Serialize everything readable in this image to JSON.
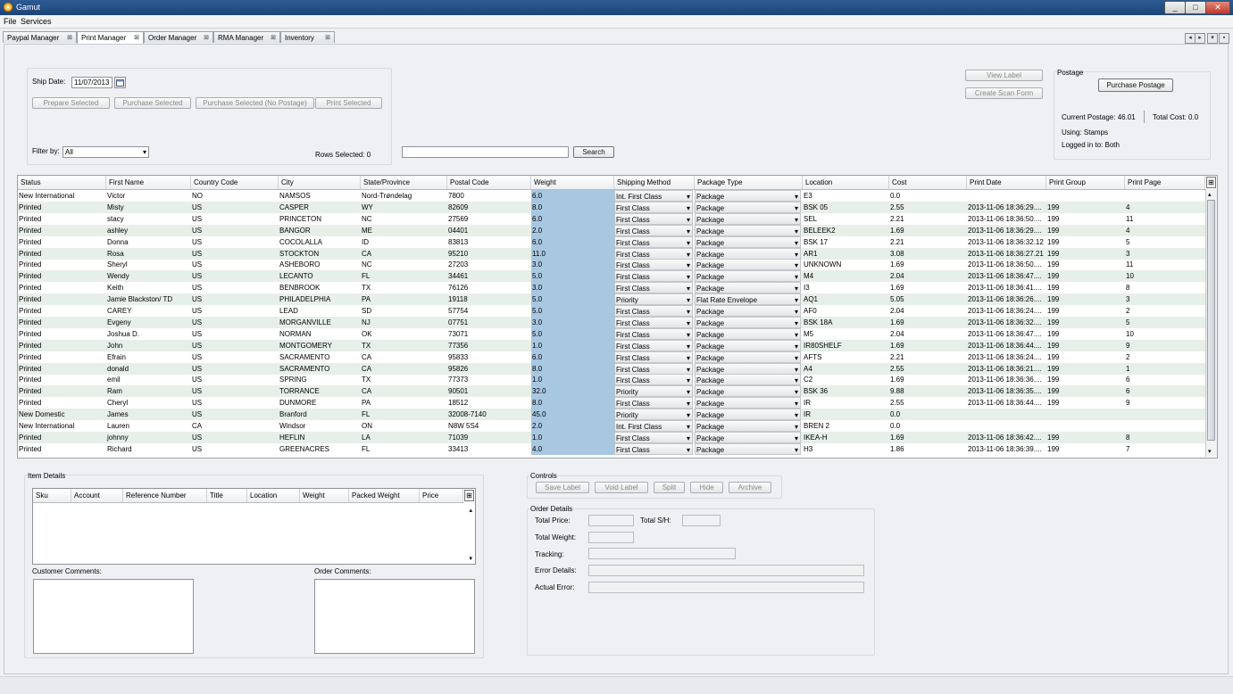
{
  "window": {
    "title": "Gamut",
    "controls": [
      "_",
      "□",
      "✕"
    ]
  },
  "menu": [
    "File",
    "Services"
  ],
  "tabs": [
    "Paypal Manager",
    "Print Manager",
    "Order Manager",
    "RMA Manager",
    "Inventory"
  ],
  "tab_close": "⊠",
  "nav": [
    "◂",
    "▸",
    "▾",
    "▪"
  ],
  "toolbar": {
    "ship_date_label": "Ship Date:",
    "ship_date_value": "11/07/2013",
    "prepare_selected": "Prepare Selected",
    "purchase_selected": "Purchase Selected",
    "purchase_no_postage": "Purchase Selected (No Postage)",
    "print_selected": "Print Selected",
    "filter_label": "Filter by:",
    "filter_value": "All",
    "rows_selected": "Rows Selected:  0",
    "search_button": "Search",
    "view_label": "View Label",
    "create_scan_form": "Create Scan Form"
  },
  "postage": {
    "title": "Postage",
    "purchase_button": "Purchase Postage",
    "current_postage": "Current Postage:  46.01",
    "total_cost": "Total Cost:  0.0",
    "using": "Using:  Stamps",
    "logged_in": "Logged in to:  Both"
  },
  "table": {
    "columns": [
      "Status",
      "First Name",
      "Country Code",
      "City",
      "State/Province",
      "Postal Code",
      "Weight",
      "Shipping Method",
      "Package Type",
      "Location",
      "Cost",
      "Print Date",
      "Print Group",
      "Print Page"
    ],
    "rows": [
      [
        "New International",
        "Victor",
        "NO",
        "NAMSOS",
        "Nord-Trøndelag",
        "7800",
        "6.0",
        "Int. First Class",
        "Package",
        "E3",
        "0.0",
        "",
        "",
        ""
      ],
      [
        "Printed",
        "Misty",
        "US",
        "CASPER",
        "WY",
        "82609",
        "8.0",
        "First Class",
        "Package",
        "BSK 05",
        "2.55",
        "2013-11-06 18:36:29....",
        "199",
        "4"
      ],
      [
        "Printed",
        "stacy",
        "US",
        "PRINCETON",
        "NC",
        "27569",
        "6.0",
        "First Class",
        "Package",
        "SEL",
        "2.21",
        "2013-11-06 18:36:50....",
        "199",
        "11"
      ],
      [
        "Printed",
        "ashley",
        "US",
        "BANGOR",
        "ME",
        "04401",
        "2.0",
        "First Class",
        "Package",
        "BELEEK2",
        "1.69",
        "2013-11-06 18:36:29....",
        "199",
        "4"
      ],
      [
        "Printed",
        "Donna",
        "US",
        "COCOLALLA",
        "ID",
        "83813",
        "6.0",
        "First Class",
        "Package",
        "BSK 17",
        "2.21",
        "2013-11-06 18:36:32.12",
        "199",
        "5"
      ],
      [
        "Printed",
        "Rosa",
        "US",
        "STOCKTON",
        "CA",
        "95210",
        "11.0",
        "First Class",
        "Package",
        "AR1",
        "3.08",
        "2013-11-06 18:36:27.21",
        "199",
        "3"
      ],
      [
        "Printed",
        "Sheryl",
        "US",
        "ASHEBORO",
        "NC",
        "27203",
        "3.0",
        "First Class",
        "Package",
        "UNKNOWN",
        "1.69",
        "2013-11-06 18:36:50....",
        "199",
        "11"
      ],
      [
        "Printed",
        "Wendy",
        "US",
        "LECANTO",
        "FL",
        "34461",
        "5.0",
        "First Class",
        "Package",
        "M4",
        "2.04",
        "2013-11-06 18:36:47....",
        "199",
        "10"
      ],
      [
        "Printed",
        "Keith",
        "US",
        "BENBROOK",
        "TX",
        "76126",
        "3.0",
        "First Class",
        "Package",
        "I3",
        "1.69",
        "2013-11-06 18:36:41....",
        "199",
        "8"
      ],
      [
        "Printed",
        "Jamie Blackston/ TD",
        "US",
        "PHILADELPHIA",
        "PA",
        "19118",
        "5.0",
        "Priority",
        "Flat Rate Envelope",
        "AQ1",
        "5.05",
        "2013-11-06 18:36:26....",
        "199",
        "3"
      ],
      [
        "Printed",
        "CAREY",
        "US",
        "LEAD",
        "SD",
        "57754",
        "5.0",
        "First Class",
        "Package",
        "AF0",
        "2.04",
        "2013-11-06 18:36:24....",
        "199",
        "2"
      ],
      [
        "Printed",
        "Evgeny",
        "US",
        "MORGANVILLE",
        "NJ",
        "07751",
        "3.0",
        "First Class",
        "Package",
        "BSK 18A",
        "1.69",
        "2013-11-06 18:36:32....",
        "199",
        "5"
      ],
      [
        "Printed",
        "Joshua D.",
        "US",
        "NORMAN",
        "OK",
        "73071",
        "5.0",
        "First Class",
        "Package",
        "M5",
        "2.04",
        "2013-11-06 18:36:47....",
        "199",
        "10"
      ],
      [
        "Printed",
        "John",
        "US",
        "MONTGOMERY",
        "TX",
        "77356",
        "1.0",
        "First Class",
        "Package",
        "IR80SHELF",
        "1.69",
        "2013-11-06 18:36:44....",
        "199",
        "9"
      ],
      [
        "Printed",
        "Efrain",
        "US",
        "SACRAMENTO",
        "CA",
        "95833",
        "6.0",
        "First Class",
        "Package",
        "AFTS",
        "2.21",
        "2013-11-06 18:36:24....",
        "199",
        "2"
      ],
      [
        "Printed",
        "donald",
        "US",
        "SACRAMENTO",
        "CA",
        "95826",
        "8.0",
        "First Class",
        "Package",
        "A4",
        "2.55",
        "2013-11-06 18:36:21....",
        "199",
        "1"
      ],
      [
        "Printed",
        "emil",
        "US",
        "SPRING",
        "TX",
        "77373",
        "1.0",
        "First Class",
        "Package",
        "C2",
        "1.69",
        "2013-11-06 18:36:36....",
        "199",
        "6"
      ],
      [
        "Printed",
        "Ram",
        "US",
        "TORRANCE",
        "CA",
        "90501",
        "32.0",
        "Priority",
        "Package",
        "BSK 36",
        "9.88",
        "2013-11-06 18:36:35....",
        "199",
        "6"
      ],
      [
        "Printed",
        "Cheryl",
        "US",
        "DUNMORE",
        "PA",
        "18512",
        "8.0",
        "First Class",
        "Package",
        "IR",
        "2.55",
        "2013-11-06 18:36:44....",
        "199",
        "9"
      ],
      [
        "New Domestic",
        "James",
        "US",
        "Branford",
        "FL",
        "32008-7140",
        "45.0",
        "Priority",
        "Package",
        "IR",
        "0.0",
        "",
        "",
        ""
      ],
      [
        "New International",
        "Lauren",
        "CA",
        "Windsor",
        "ON",
        "N8W 5S4",
        "2.0",
        "Int. First Class",
        "Package",
        "BREN 2",
        "0.0",
        "",
        "",
        ""
      ],
      [
        "Printed",
        "johnny",
        "US",
        "HEFLIN",
        "LA",
        "71039",
        "1.0",
        "First Class",
        "Package",
        "IKEA-H",
        "1.69",
        "2013-11-06 18:36:42....",
        "199",
        "8"
      ],
      [
        "Printed",
        "Richard",
        "US",
        "GREENACRES",
        "FL",
        "33413",
        "4.0",
        "First Class",
        "Package",
        "H3",
        "1.86",
        "2013-11-06 18:36:39....",
        "199",
        "7"
      ]
    ]
  },
  "item_details": {
    "title": "Item Details",
    "columns": [
      "Sku",
      "Account",
      "Reference Number",
      "Title",
      "Location",
      "Weight",
      "Packed Weight",
      "Price"
    ],
    "customer_comments": "Customer Comments:",
    "order_comments": "Order Comments:"
  },
  "controls": {
    "title": "Controls",
    "buttons": [
      "Save Label",
      "Void Label",
      "Split",
      "Hide",
      "Archive"
    ]
  },
  "order_details": {
    "title": "Order Details",
    "total_price": "Total Price:",
    "total_sh": "Total S/H:",
    "total_weight": "Total Weight:",
    "tracking": "Tracking:",
    "error_details": "Error Details:",
    "actual_error": "Actual Error:"
  }
}
